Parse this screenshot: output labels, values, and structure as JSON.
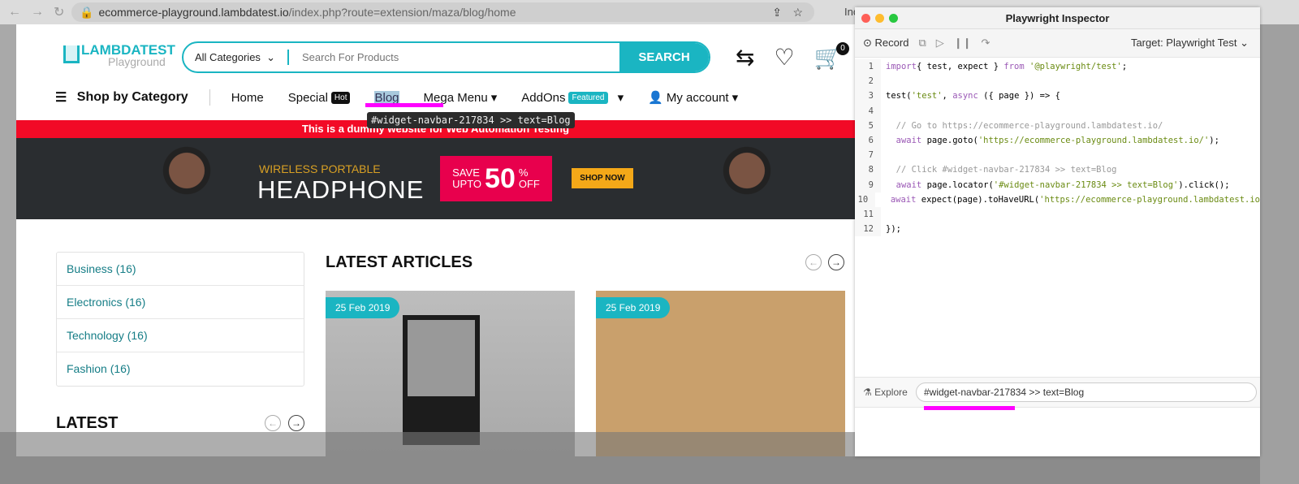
{
  "browser": {
    "url_host": "ecommerce-playground.lambdatest.io",
    "url_path": "/index.php?route=extension/maza/blog/home",
    "profile": "Inc"
  },
  "header": {
    "logo_top": "LAMBDATEST",
    "logo_bottom": "Playground",
    "category_select": "All Categories",
    "search_placeholder": "Search For Products",
    "search_button": "SEARCH",
    "cart_count": "0"
  },
  "menu": {
    "shop_by_category": "Shop by Category",
    "items": [
      {
        "label": "Home"
      },
      {
        "label": "Special",
        "badge": "Hot"
      },
      {
        "label": "Blog"
      },
      {
        "label": "Mega Menu"
      },
      {
        "label": "AddOns",
        "badge": "Featured"
      },
      {
        "label": "My account"
      }
    ]
  },
  "tooltip": "#widget-navbar-217834 >> text=Blog",
  "notice": "This is a dummy website for Web Automation Testing",
  "hero": {
    "subtitle": "WIRELESS PORTABLE",
    "title": "HEADPHONE",
    "save": "SAVE",
    "upto": "UPTO",
    "percent_value": "50",
    "percent": "%",
    "off": "OFF",
    "cta": "SHOP NOW"
  },
  "sidebar": {
    "categories": [
      "Business (16)",
      "Electronics (16)",
      "Technology (16)",
      "Fashion (16)"
    ],
    "latest_title": "LATEST"
  },
  "articles": {
    "title": "LATEST ARTICLES",
    "cards": [
      {
        "date": "25 Feb 2019"
      },
      {
        "date": "25 Feb 2019"
      }
    ]
  },
  "inspector": {
    "title": "Playwright Inspector",
    "record": "Record",
    "target": "Target: Playwright Test",
    "code": [
      {
        "n": "1",
        "parts": [
          [
            "kw",
            "import"
          ],
          [
            "",
            "{ test, expect } "
          ],
          [
            "kw",
            "from"
          ],
          [
            "str",
            " '@playwright/test'"
          ],
          [
            "",
            ";"
          ]
        ]
      },
      {
        "n": "2",
        "parts": []
      },
      {
        "n": "3",
        "parts": [
          [
            "",
            "test("
          ],
          [
            "str",
            "'test'"
          ],
          [
            "",
            ", "
          ],
          [
            "kw",
            "async"
          ],
          [
            "",
            " ({ page }) => {"
          ]
        ]
      },
      {
        "n": "4",
        "parts": []
      },
      {
        "n": "5",
        "parts": [
          [
            "cm",
            "  // Go to https://ecommerce-playground.lambdatest.io/"
          ]
        ]
      },
      {
        "n": "6",
        "parts": [
          [
            "kw",
            "  await"
          ],
          [
            "",
            " page.goto("
          ],
          [
            "str",
            "'https://ecommerce-playground.lambdatest.io/'"
          ],
          [
            "",
            ");"
          ]
        ]
      },
      {
        "n": "7",
        "parts": []
      },
      {
        "n": "8",
        "parts": [
          [
            "cm",
            "  // Click #widget-navbar-217834 >> text=Blog"
          ]
        ]
      },
      {
        "n": "9",
        "parts": [
          [
            "kw",
            "  await"
          ],
          [
            "",
            " page.locator("
          ],
          [
            "str",
            "'#widget-navbar-217834 >> text=Blog'"
          ],
          [
            "",
            ").click();"
          ]
        ]
      },
      {
        "n": "10",
        "parts": [
          [
            "kw",
            "  await"
          ],
          [
            "",
            " expect(page).toHaveURL("
          ],
          [
            "str",
            "'https://ecommerce-playground.lambdatest.io"
          ]
        ]
      },
      {
        "n": "11",
        "parts": []
      },
      {
        "n": "12",
        "parts": [
          [
            "",
            "});"
          ]
        ]
      }
    ],
    "explore_label": "Explore",
    "explore_value": "#widget-navbar-217834 >> text=Blog"
  },
  "colors": {
    "accent": "#1ab5c2",
    "notice": "#f20a26",
    "highlight": "#ff00ff"
  }
}
